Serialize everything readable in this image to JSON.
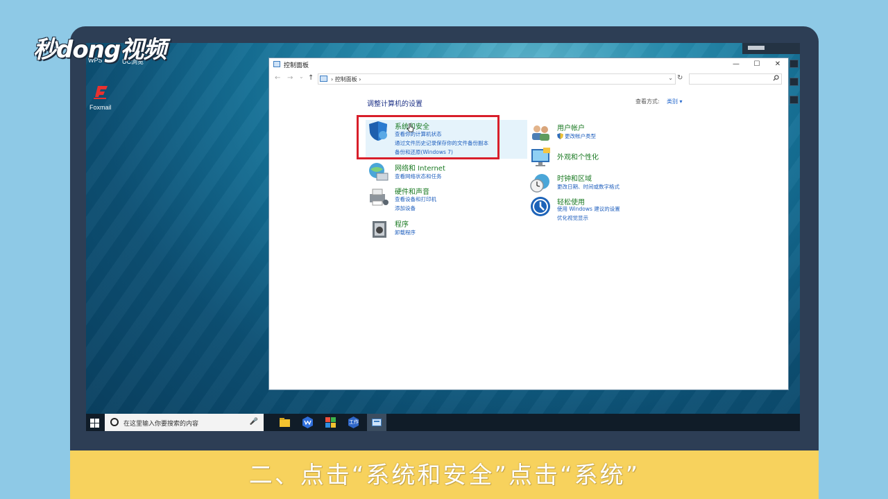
{
  "watermark": {
    "logo_text": "秒dong视频"
  },
  "desktop": {
    "top_labels": [
      "WPS",
      "9",
      "UC浏览"
    ],
    "foxmail_label": "Foxmail"
  },
  "window": {
    "title": "控制面板",
    "controls": {
      "minimize": "—",
      "maximize": "☐",
      "close": "✕"
    },
    "nav": {
      "back": "←",
      "forward": "→",
      "down": "⌄",
      "up": "↑"
    },
    "address": {
      "breadcrumb": "› 控制面板 ›",
      "dropdown": "⌄",
      "refresh": "↻"
    },
    "search": {
      "placeholder": "",
      "icon": "search-icon"
    },
    "heading": "调整计算机的设置",
    "view_by_label": "查看方式:",
    "view_by_value": "类别 ▾",
    "categories": [
      {
        "title": "系统和安全",
        "links": [
          "查看你的计算机状态",
          "通过文件历史记录保存你的文件备份副本",
          "备份和还原(Windows 7)"
        ]
      },
      {
        "title": "网络和 Internet",
        "links": [
          "查看网络状态和任务"
        ]
      },
      {
        "title": "硬件和声音",
        "links": [
          "查看设备和打印机",
          "添加设备"
        ]
      },
      {
        "title": "程序",
        "links": [
          "卸载程序"
        ]
      },
      {
        "title": "用户帐户",
        "links": [
          "更改帐户类型"
        ]
      },
      {
        "title": "外观和个性化",
        "links": []
      },
      {
        "title": "时钟和区域",
        "links": [
          "更改日期、时间或数字格式"
        ]
      },
      {
        "title": "轻松使用",
        "links": [
          "使用 Windows 建议的设置",
          "优化视觉显示"
        ]
      }
    ]
  },
  "taskbar": {
    "search_placeholder": "在这里输入你要搜索的内容",
    "work_label": "工作",
    "mic": "🎤"
  },
  "caption": "二、点击“系统和安全”点击“系统”",
  "colors": {
    "highlight_border": "#d81e2a",
    "link": "#1f5fbe",
    "category_title": "#1b7a23",
    "caption_bar": "#f7d25d"
  }
}
